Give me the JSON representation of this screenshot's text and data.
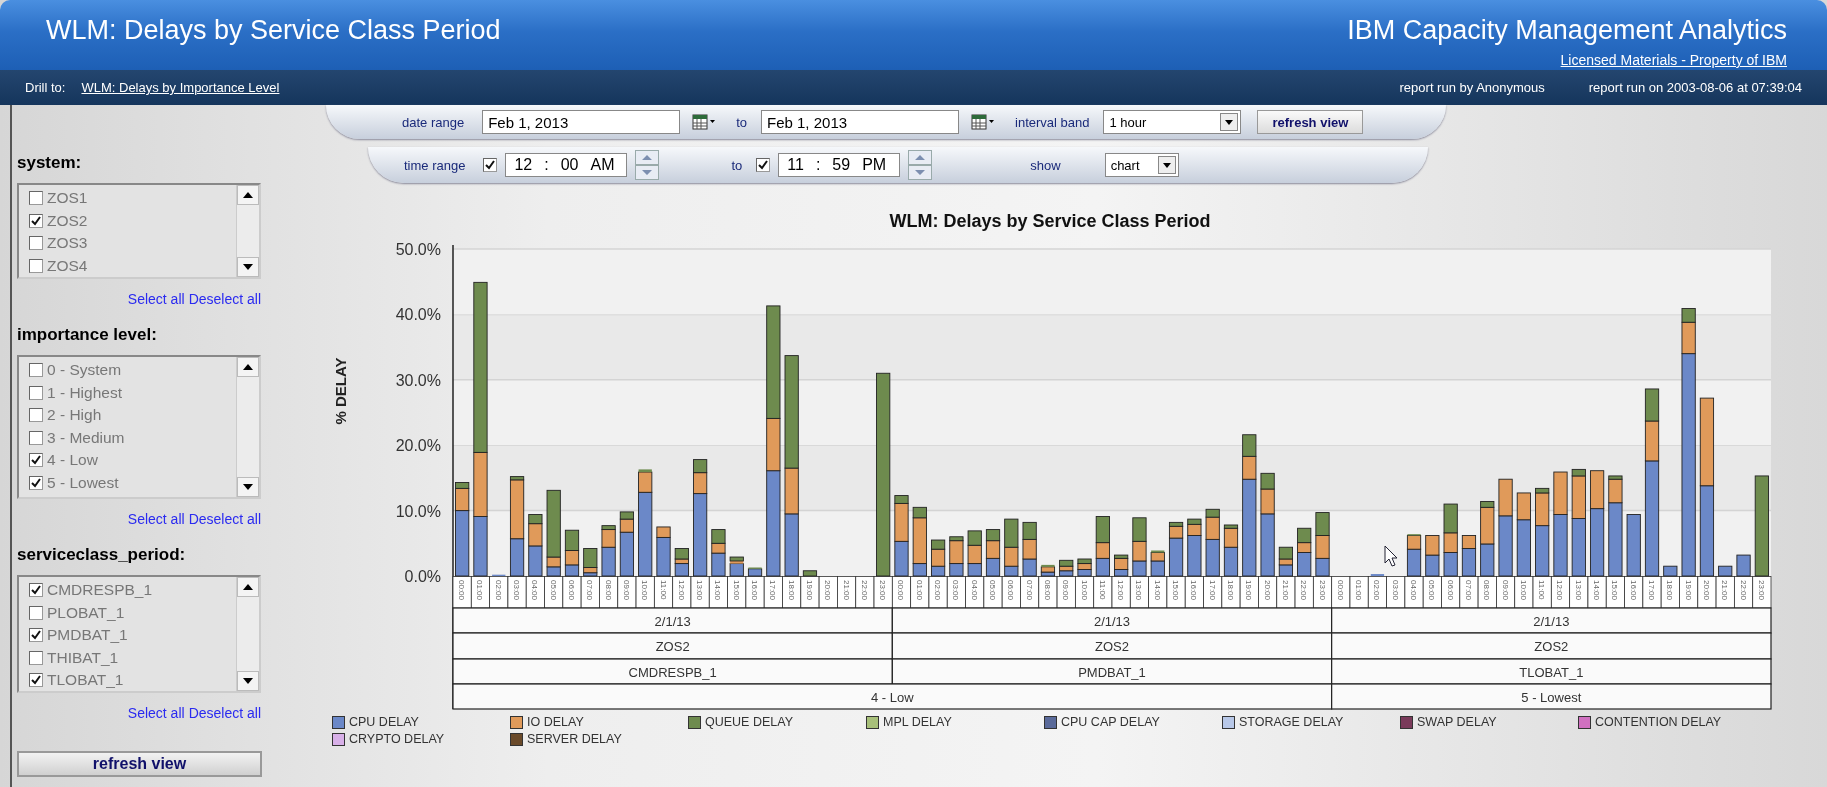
{
  "header": {
    "title": "WLM: Delays by Service Class Period",
    "product": "IBM Capacity Management Analytics",
    "license_link": "Licensed Materials - Property of IBM"
  },
  "navbar": {
    "drill_label": "Drill to:",
    "drill_link": "WLM: Delays by Importance Level",
    "run_by": "report run by Anonymous",
    "run_on": "report run on 2003-08-06 at 07:39:04"
  },
  "filters": [
    {
      "title": "system:",
      "items": [
        {
          "label": "ZOS1",
          "checked": false
        },
        {
          "label": "ZOS2",
          "checked": true
        },
        {
          "label": "ZOS3",
          "checked": false
        },
        {
          "label": "ZOS4",
          "checked": false
        }
      ],
      "links": [
        "Select all",
        "Deselect all"
      ]
    },
    {
      "title": "importance level:",
      "items": [
        {
          "label": "0 - System",
          "checked": false
        },
        {
          "label": "1 - Highest",
          "checked": false
        },
        {
          "label": "2 - High",
          "checked": false
        },
        {
          "label": "3 - Medium",
          "checked": false
        },
        {
          "label": "4 - Low",
          "checked": true
        },
        {
          "label": "5 - Lowest",
          "checked": true
        }
      ],
      "links": [
        "Select all",
        "Deselect all"
      ]
    },
    {
      "title": "serviceclass_period:",
      "items": [
        {
          "label": "CMDRESPB_1",
          "checked": true
        },
        {
          "label": "PLOBAT_1",
          "checked": false
        },
        {
          "label": "PMDBAT_1",
          "checked": true
        },
        {
          "label": "THIBAT_1",
          "checked": false
        },
        {
          "label": "TLOBAT_1",
          "checked": true
        }
      ],
      "links": [
        "Select all",
        "Deselect all"
      ]
    }
  ],
  "sidebar_button": "refresh view",
  "toolbar": {
    "date_label": "date range",
    "date_from": "Feb 1, 2013",
    "date_to_label": "to",
    "date_to": "Feb 1, 2013",
    "interval_label": "interval band",
    "interval": "1 hour",
    "refresh": "refresh view",
    "time_label": "time range",
    "from_enabled": true,
    "from_hour": "12",
    "from_sep": ":",
    "from_minute": "00",
    "from_ampm": "AM",
    "time_to_label": "to",
    "to_enabled": true,
    "to_hour": "11",
    "to_sep": ":",
    "to_minute": "59",
    "to_ampm": "PM",
    "show_label": "show",
    "show": "chart"
  },
  "chart": {
    "groups": [
      {
        "importance": "4 - Low",
        "classes": [
          {
            "date": "2/1/13",
            "system": "ZOS2",
            "name": "CMDRESPB_1"
          },
          {
            "date": "2/1/13",
            "system": "ZOS2",
            "name": "PMDBAT_1"
          }
        ]
      },
      {
        "importance": "5 - Lowest",
        "classes": [
          {
            "date": "2/1/13",
            "system": "ZOS2",
            "name": "TLOBAT_1"
          }
        ]
      }
    ],
    "chart_data": {
      "type": "bar",
      "title": "WLM: Delays by Service Class Period",
      "ylabel": "% DELAY",
      "stacked": true,
      "grid": true,
      "ylim": [
        0,
        50
      ],
      "yticks": [
        {
          "value": 0,
          "label": "0.0%"
        },
        {
          "value": 10,
          "label": "10.0%"
        },
        {
          "value": 20,
          "label": "20.0%"
        },
        {
          "value": 30,
          "label": "30.0%"
        },
        {
          "value": 40,
          "label": "40.0%"
        },
        {
          "value": 50,
          "label": "50.0%"
        }
      ],
      "categories": [
        "00:00",
        "01:00",
        "02:00",
        "03:00",
        "04:00",
        "05:00",
        "06:00",
        "07:00",
        "08:00",
        "09:00",
        "10:00",
        "11:00",
        "12:00",
        "13:00",
        "14:00",
        "15:00",
        "16:00",
        "17:00",
        "18:00",
        "19:00",
        "20:00",
        "21:00",
        "22:00",
        "23:00",
        "00:00",
        "01:00",
        "02:00",
        "03:00",
        "04:00",
        "05:00",
        "06:00",
        "07:00",
        "08:00",
        "09:00",
        "10:00",
        "11:00",
        "12:00",
        "13:00",
        "14:00",
        "15:00",
        "16:00",
        "17:00",
        "18:00",
        "19:00",
        "20:00",
        "21:00",
        "22:00",
        "23:00",
        "00:00",
        "01:00",
        "02:00",
        "03:00",
        "04:00",
        "05:00",
        "06:00",
        "07:00",
        "08:00",
        "09:00",
        "10:00",
        "11:00",
        "12:00",
        "13:00",
        "14:00",
        "15:00",
        "16:00",
        "17:00",
        "18:00",
        "19:00",
        "20:00",
        "21:00",
        "22:00",
        "23:00"
      ],
      "series": [
        {
          "name": "CPU DELAY",
          "color": "#6b88c8",
          "values": [
            10.0,
            9.1,
            0.2,
            5.7,
            4.6,
            1.4,
            1.7,
            0.5,
            4.4,
            6.7,
            12.8,
            5.9,
            1.9,
            12.6,
            3.5,
            1.9,
            1.1,
            16.1,
            9.5,
            null,
            null,
            null,
            null,
            null,
            5.3,
            1.9,
            1.5,
            1.9,
            1.9,
            2.7,
            1.5,
            2.6,
            0.6,
            0.8,
            1.0,
            2.7,
            1.0,
            2.3,
            2.3,
            5.8,
            6.2,
            5.6,
            4.4,
            14.8,
            9.5,
            1.7,
            3.6,
            2.7,
            null,
            null,
            0.3,
            null,
            4.1,
            3.2,
            3.6,
            4.2,
            4.9,
            9.2,
            8.6,
            7.7,
            9.4,
            8.8,
            10.3,
            11.2,
            9.4,
            17.6,
            1.5,
            34.0,
            13.8,
            1.5,
            3.2,
            null
          ]
        },
        {
          "name": "IO DELAY",
          "color": "#e09a5a",
          "values": [
            3.4,
            9.8,
            null,
            9.0,
            3.4,
            1.5,
            2.2,
            0.8,
            2.7,
            2.0,
            3.1,
            1.6,
            0.7,
            3.2,
            1.5,
            0.4,
            null,
            8.0,
            7.0,
            null,
            null,
            null,
            null,
            null,
            5.8,
            7.0,
            2.6,
            3.5,
            2.8,
            2.7,
            2.9,
            3.0,
            0.8,
            0.7,
            0.9,
            2.4,
            1.7,
            3.0,
            1.3,
            1.8,
            1.7,
            3.4,
            2.9,
            3.5,
            3.8,
            0.9,
            1.5,
            3.5,
            null,
            null,
            null,
            null,
            2.1,
            3.0,
            3.0,
            2.0,
            5.6,
            5.6,
            4.1,
            5.0,
            6.5,
            6.5,
            5.8,
            3.6,
            null,
            6.1,
            null,
            4.8,
            13.4,
            null,
            null,
            null
          ]
        },
        {
          "name": "QUEUE DELAY",
          "color": "#6e8b4e",
          "values": [
            0.9,
            26.0,
            null,
            0.5,
            1.4,
            10.2,
            3.1,
            2.9,
            0.6,
            1.1,
            0.4,
            null,
            1.6,
            2.0,
            2.1,
            0.6,
            0.2,
            17.2,
            17.2,
            0.8,
            null,
            null,
            null,
            31.0,
            1.2,
            1.6,
            1.4,
            0.6,
            2.2,
            1.7,
            4.3,
            2.6,
            0.3,
            0.9,
            0.7,
            4.0,
            0.5,
            3.6,
            0.3,
            0.6,
            0.8,
            1.2,
            0.5,
            3.3,
            2.4,
            1.8,
            2.2,
            3.5,
            null,
            null,
            null,
            null,
            0.2,
            null,
            4.4,
            null,
            0.9,
            null,
            null,
            0.7,
            null,
            1.0,
            null,
            0.5,
            null,
            4.9,
            null,
            2.1,
            null,
            null,
            null,
            15.3
          ]
        },
        {
          "name": "MPL DELAY",
          "color": "#a8c07a",
          "values": [
            null,
            null,
            null,
            null,
            null,
            null,
            null,
            null,
            null,
            null,
            null,
            null,
            null,
            null,
            null,
            null,
            null,
            null,
            null,
            null,
            null,
            null,
            null,
            null,
            null,
            null,
            null,
            null,
            null,
            null,
            null,
            null,
            null,
            null,
            null,
            null,
            null,
            null,
            null,
            null,
            null,
            null,
            null,
            null,
            null,
            null,
            null,
            null,
            null,
            null,
            null,
            null,
            null,
            null,
            null,
            null,
            null,
            null,
            null,
            null,
            null,
            null,
            null,
            null,
            null,
            null,
            null,
            null,
            null,
            null,
            null,
            null
          ]
        },
        {
          "name": "CPU CAP DELAY",
          "color": "#5a6a9a",
          "values": [
            null,
            null,
            null,
            null,
            null,
            null,
            null,
            null,
            null,
            null,
            null,
            null,
            null,
            null,
            null,
            null,
            null,
            null,
            null,
            null,
            null,
            null,
            null,
            null,
            null,
            null,
            null,
            null,
            null,
            null,
            null,
            null,
            null,
            null,
            null,
            null,
            null,
            null,
            null,
            null,
            null,
            null,
            null,
            null,
            null,
            null,
            null,
            null,
            null,
            null,
            null,
            null,
            null,
            null,
            null,
            null,
            null,
            null,
            null,
            null,
            null,
            null,
            null,
            null,
            null,
            null,
            null,
            null,
            null,
            null,
            null,
            null
          ]
        },
        {
          "name": "STORAGE DELAY",
          "color": "#b8c8e8",
          "values": [
            null,
            null,
            null,
            null,
            null,
            null,
            null,
            null,
            null,
            null,
            null,
            null,
            null,
            null,
            null,
            null,
            null,
            null,
            null,
            null,
            null,
            null,
            null,
            null,
            null,
            null,
            null,
            null,
            null,
            null,
            null,
            null,
            null,
            null,
            null,
            null,
            null,
            null,
            null,
            null,
            null,
            null,
            null,
            null,
            null,
            null,
            null,
            null,
            null,
            null,
            null,
            null,
            null,
            null,
            null,
            null,
            null,
            null,
            null,
            null,
            null,
            null,
            null,
            null,
            null,
            null,
            null,
            null,
            null,
            null,
            null,
            null
          ]
        },
        {
          "name": "SWAP DELAY",
          "color": "#7a3a5a",
          "values": [
            null,
            null,
            null,
            null,
            null,
            null,
            null,
            null,
            null,
            null,
            null,
            null,
            null,
            null,
            null,
            null,
            null,
            null,
            null,
            null,
            null,
            null,
            null,
            null,
            null,
            null,
            null,
            null,
            null,
            null,
            null,
            null,
            null,
            null,
            null,
            null,
            null,
            null,
            null,
            null,
            null,
            null,
            null,
            null,
            null,
            null,
            null,
            null,
            null,
            null,
            null,
            null,
            null,
            null,
            null,
            null,
            null,
            null,
            null,
            null,
            null,
            null,
            null,
            null,
            null,
            null,
            null,
            null,
            null,
            null,
            null,
            null
          ]
        },
        {
          "name": "CONTENTION DELAY",
          "color": "#d070c0",
          "values": [
            null,
            null,
            null,
            null,
            null,
            null,
            null,
            null,
            null,
            null,
            null,
            null,
            null,
            null,
            null,
            null,
            null,
            null,
            null,
            null,
            null,
            null,
            null,
            null,
            null,
            null,
            null,
            null,
            null,
            null,
            null,
            null,
            null,
            null,
            null,
            null,
            null,
            null,
            null,
            null,
            null,
            null,
            null,
            null,
            null,
            null,
            null,
            null,
            null,
            null,
            null,
            null,
            null,
            null,
            null,
            null,
            null,
            null,
            null,
            null,
            null,
            null,
            null,
            null,
            null,
            null,
            null,
            null,
            null,
            null,
            null,
            null
          ]
        },
        {
          "name": "CRYPTO DELAY",
          "color": "#d8b0e8",
          "values": [
            null,
            null,
            null,
            null,
            null,
            null,
            null,
            null,
            null,
            null,
            null,
            null,
            null,
            null,
            null,
            null,
            null,
            null,
            null,
            null,
            null,
            null,
            null,
            null,
            null,
            null,
            null,
            null,
            null,
            null,
            null,
            null,
            null,
            null,
            null,
            null,
            null,
            null,
            null,
            null,
            null,
            null,
            null,
            null,
            null,
            null,
            null,
            null,
            null,
            null,
            null,
            null,
            null,
            null,
            null,
            null,
            null,
            null,
            null,
            null,
            null,
            null,
            null,
            null,
            null,
            null,
            null,
            null,
            null,
            null,
            null,
            null
          ]
        },
        {
          "name": "SERVER DELAY",
          "color": "#6a4a2a",
          "values": [
            null,
            null,
            null,
            null,
            null,
            null,
            null,
            null,
            null,
            null,
            null,
            null,
            null,
            null,
            null,
            null,
            null,
            null,
            null,
            null,
            null,
            null,
            null,
            null,
            null,
            null,
            null,
            null,
            null,
            null,
            null,
            null,
            null,
            null,
            null,
            null,
            null,
            null,
            null,
            null,
            null,
            null,
            null,
            null,
            null,
            null,
            null,
            null,
            null,
            null,
            null,
            null,
            null,
            null,
            null,
            null,
            null,
            null,
            null,
            null,
            null,
            null,
            null,
            null,
            null,
            null,
            null,
            null,
            null,
            null,
            null,
            null
          ]
        }
      ]
    }
  }
}
